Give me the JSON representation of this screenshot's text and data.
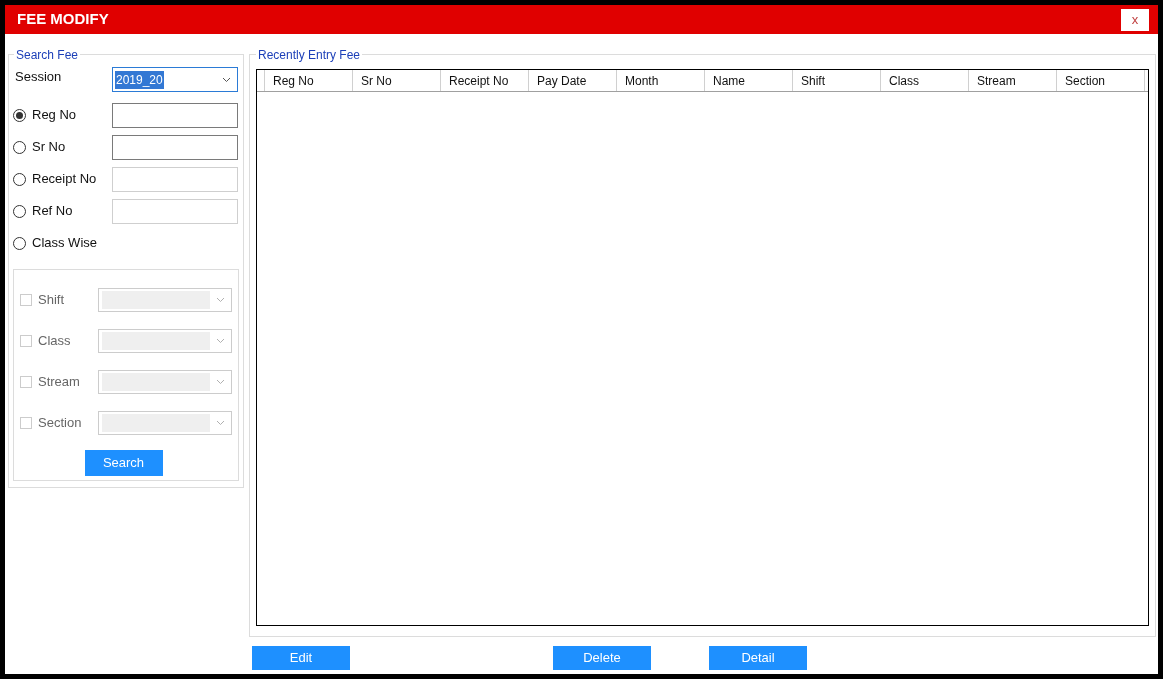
{
  "window": {
    "title": "FEE MODIFY",
    "close": "x"
  },
  "search_fee": {
    "title": "Search Fee",
    "session": {
      "label": "Session",
      "value": "2019_20"
    },
    "options": [
      {
        "label": "Reg No",
        "selected": true,
        "kind": "field"
      },
      {
        "label": "Sr No",
        "selected": false,
        "kind": "field"
      },
      {
        "label": "Receipt No",
        "selected": false,
        "kind": "field"
      },
      {
        "label": "Ref No",
        "selected": false,
        "kind": "field"
      },
      {
        "label": "Class Wise",
        "selected": false,
        "kind": "plain"
      }
    ],
    "filters": [
      {
        "label": "Shift",
        "checked": false,
        "disabled": true
      },
      {
        "label": "Class",
        "checked": false,
        "disabled": true
      },
      {
        "label": "Stream",
        "checked": false,
        "disabled": true
      },
      {
        "label": "Section",
        "checked": false,
        "disabled": true
      }
    ],
    "search_button": "Search"
  },
  "recent": {
    "title": "Recently Entry Fee",
    "columns": [
      "Reg No",
      "Sr No",
      "Receipt No",
      "Pay Date",
      "Month",
      "Name",
      "Shift",
      "Class",
      "Stream",
      "Section"
    ]
  },
  "buttons": [
    "Edit",
    "Delete",
    "Detail"
  ]
}
